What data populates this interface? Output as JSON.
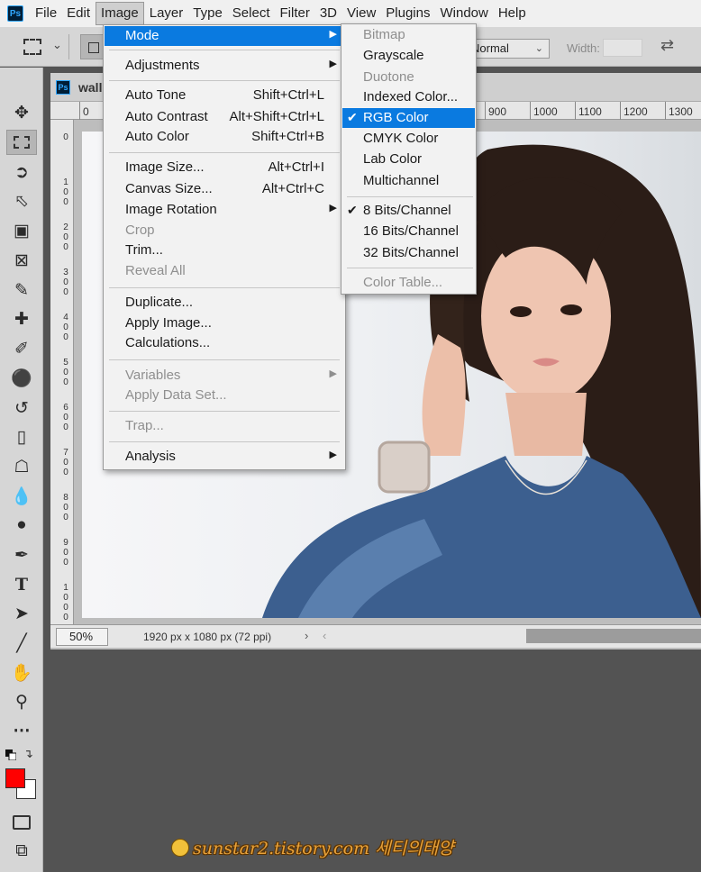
{
  "app": {
    "logo_text": "Ps"
  },
  "menubar": {
    "items": [
      "File",
      "Edit",
      "Image",
      "Layer",
      "Type",
      "Select",
      "Filter",
      "3D",
      "View",
      "Plugins",
      "Window",
      "Help"
    ],
    "active": "Image"
  },
  "options_bar": {
    "style_value": "Normal",
    "width_label": "Width:"
  },
  "toolbar": {
    "tools": [
      "move-tool",
      "rectangular-marquee-tool",
      "lasso-tool",
      "object-selection-tool",
      "crop-tool",
      "frame-tool",
      "eyedropper-tool",
      "spot-healing-brush-tool",
      "brush-tool",
      "clone-stamp-tool",
      "history-brush-tool",
      "eraser-tool",
      "paint-bucket-tool",
      "blur-tool",
      "dodge-tool",
      "pen-tool",
      "type-tool",
      "path-selection-tool",
      "line-tool",
      "hand-tool",
      "zoom-tool",
      "edit-toolbar"
    ],
    "selected": "rectangular-marquee-tool",
    "foreground_color": "#ff0000",
    "background_color": "#ffffff"
  },
  "document": {
    "tab_title": "wall",
    "ruler_h_labels": [
      "0",
      "900",
      "1000",
      "1100",
      "1200",
      "1300"
    ],
    "ruler_v_labels": [
      "0",
      "100",
      "200",
      "300",
      "400",
      "500",
      "600",
      "700",
      "800",
      "900",
      "1000"
    ],
    "zoom": "50%",
    "info": "1920 px x 1080 px (72 ppi)"
  },
  "image_menu": {
    "items": [
      {
        "label": "Mode",
        "shortcut": "",
        "submenu": true,
        "disabled": false,
        "highlighted": true
      },
      {
        "label": "Adjustments",
        "shortcut": "",
        "submenu": true,
        "disabled": false
      },
      {
        "label": "Auto Tone",
        "shortcut": "Shift+Ctrl+L",
        "disabled": false
      },
      {
        "label": "Auto Contrast",
        "shortcut": "Alt+Shift+Ctrl+L",
        "disabled": false
      },
      {
        "label": "Auto Color",
        "shortcut": "Shift+Ctrl+B",
        "disabled": false
      },
      {
        "label": "Image Size...",
        "shortcut": "Alt+Ctrl+I",
        "disabled": false
      },
      {
        "label": "Canvas Size...",
        "shortcut": "Alt+Ctrl+C",
        "disabled": false
      },
      {
        "label": "Image Rotation",
        "shortcut": "",
        "submenu": true,
        "disabled": false
      },
      {
        "label": "Crop",
        "shortcut": "",
        "disabled": true
      },
      {
        "label": "Trim...",
        "shortcut": "",
        "disabled": false
      },
      {
        "label": "Reveal All",
        "shortcut": "",
        "disabled": true
      },
      {
        "label": "Duplicate...",
        "shortcut": "",
        "disabled": false
      },
      {
        "label": "Apply Image...",
        "shortcut": "",
        "disabled": false
      },
      {
        "label": "Calculations...",
        "shortcut": "",
        "disabled": false
      },
      {
        "label": "Variables",
        "shortcut": "",
        "submenu": true,
        "disabled": true
      },
      {
        "label": "Apply Data Set...",
        "shortcut": "",
        "disabled": true
      },
      {
        "label": "Trap...",
        "shortcut": "",
        "disabled": true
      },
      {
        "label": "Analysis",
        "shortcut": "",
        "submenu": true,
        "disabled": false
      }
    ]
  },
  "mode_menu": {
    "items": [
      {
        "label": "Bitmap",
        "disabled": true
      },
      {
        "label": "Grayscale",
        "disabled": false
      },
      {
        "label": "Duotone",
        "disabled": true
      },
      {
        "label": "Indexed Color...",
        "disabled": false
      },
      {
        "label": "RGB Color",
        "checked": true,
        "highlighted": true
      },
      {
        "label": "CMYK Color",
        "disabled": false
      },
      {
        "label": "Lab Color",
        "disabled": false
      },
      {
        "label": "Multichannel",
        "disabled": false
      },
      {
        "label": "8 Bits/Channel",
        "checked": true
      },
      {
        "label": "16 Bits/Channel",
        "disabled": false
      },
      {
        "label": "32 Bits/Channel",
        "disabled": false
      },
      {
        "label": "Color Table...",
        "disabled": true
      }
    ]
  },
  "watermark": {
    "text": "sunstar2.tistory.com 세티의태양"
  }
}
